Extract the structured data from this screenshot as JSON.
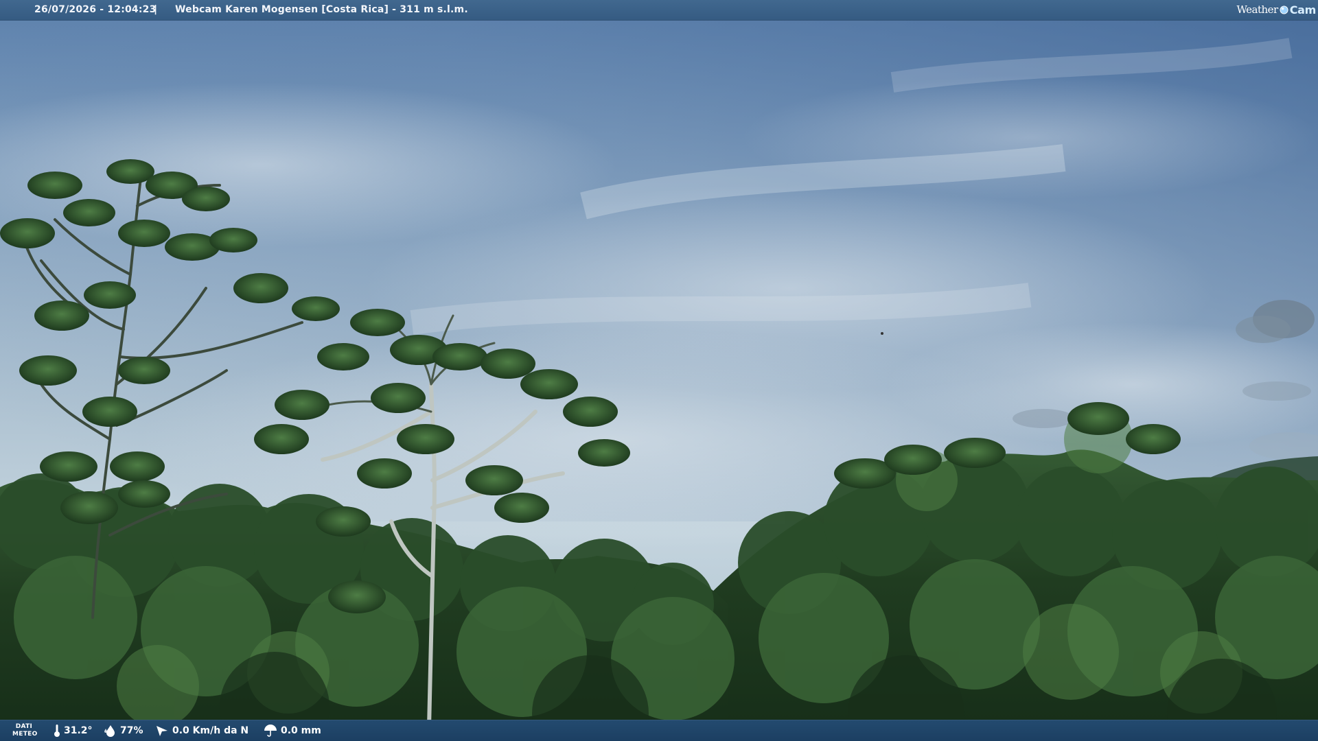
{
  "overlay": {
    "datetime": "26/07/2026 - 12:04:23",
    "separator": "|",
    "location": "Webcam Karen Mogensen [Costa Rica] - 311 m s.l.m.",
    "brand_weather": "Weather",
    "brand_cam": "Cam"
  },
  "weather": {
    "label_line1": "DATI",
    "label_line2": "METEO",
    "temperature": "31.2°",
    "humidity": "77%",
    "wind": "0.0 Km/h da N",
    "rain": "0.0 mm"
  },
  "icons": {
    "temperature": "thermometer-icon",
    "humidity": "humidity-drop-icon",
    "wind": "wind-direction-icon",
    "rain": "rain-umbrella-icon",
    "brand": "globe-icon"
  },
  "colors": {
    "top_bar": "#3c6289",
    "bottom_bar": "#21466b",
    "sky_top": "#5d82ad",
    "sky_bottom": "#b7cad6",
    "forest": "#234223"
  }
}
